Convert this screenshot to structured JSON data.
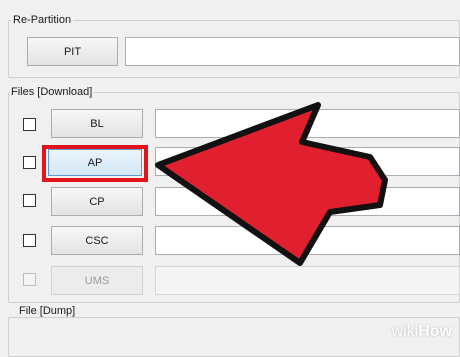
{
  "repartition": {
    "group_label": "Re-Partition",
    "pit_label": "PIT"
  },
  "files_download": {
    "group_label": "Files [Download]",
    "rows": [
      {
        "label": "BL",
        "checked": false,
        "enabled": true,
        "selected": false
      },
      {
        "label": "AP",
        "checked": false,
        "enabled": true,
        "selected": true
      },
      {
        "label": "CP",
        "checked": false,
        "enabled": true,
        "selected": false
      },
      {
        "label": "CSC",
        "checked": false,
        "enabled": true,
        "selected": false
      },
      {
        "label": "UMS",
        "checked": false,
        "enabled": false,
        "selected": false
      }
    ]
  },
  "file_dump": {
    "group_label": "File [Dump]"
  },
  "annotation": {
    "highlight_color": "#e1141b",
    "arrow_color": "#e0202f",
    "arrow_target": "AP"
  },
  "watermark": {
    "prefix": "wiki",
    "suffix": "How"
  }
}
